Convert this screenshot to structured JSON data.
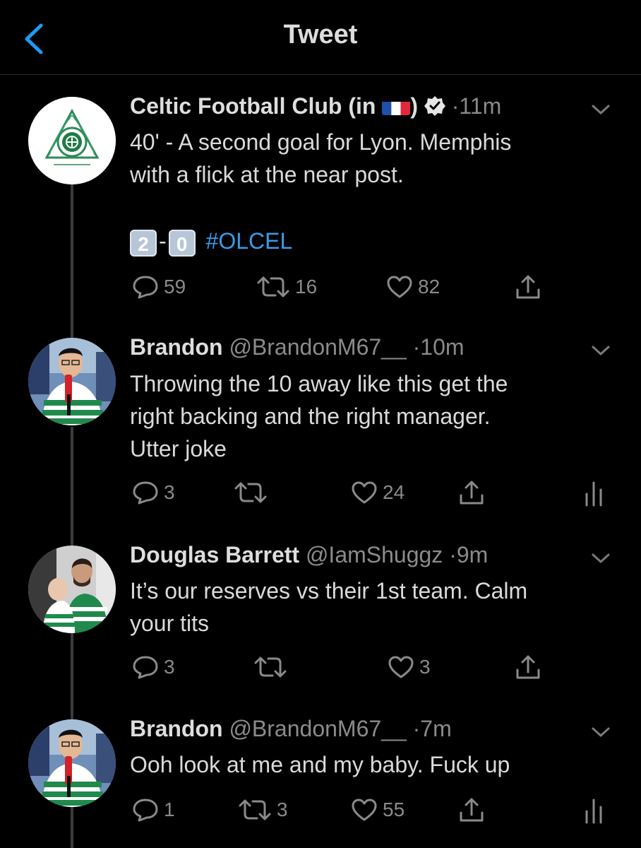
{
  "header": {
    "title": "Tweet"
  },
  "tweets": [
    {
      "name": "Celtic Football Club (in",
      "name_suffix": ")",
      "handle": "",
      "time": "11m",
      "text_line1": "40' - A second goal for Lyon. Memphis",
      "text_line2": "with a flick at the near post.",
      "score_home": "2",
      "score_sep": "-",
      "score_away": "0",
      "hashtag": "#OLCEL",
      "replies": "59",
      "retweets": "16",
      "likes": "82"
    },
    {
      "name": "Brandon",
      "handle": "@BrandonM67__",
      "time": "10m",
      "text_line1": "Throwing the 10 away like this get the",
      "text_line2": "right backing and the right manager.",
      "text_line3": "Utter joke",
      "replies": "3",
      "retweets": "",
      "likes": "24"
    },
    {
      "name": "Douglas Barrett",
      "handle": "@IamShuggz",
      "time": "9m",
      "text_line1": "It’s our reserves vs their 1st team. Calm",
      "text_line2": "your tits",
      "replies": "3",
      "retweets": "",
      "likes": "3"
    },
    {
      "name": "Brandon",
      "handle": "@BrandonM67__",
      "time": "7m",
      "text_line1": "Ooh look at me and my baby. Fuck up",
      "replies": "1",
      "retweets": "3",
      "likes": "55"
    }
  ],
  "time_separator": "·",
  "colors": {
    "background": "#000000",
    "accent": "#1d9bf0",
    "hashtag": "#3a9ae8",
    "text_primary": "#dadada",
    "text_secondary": "#8a8a8a",
    "thread_line": "#3b3b3b"
  },
  "icons": [
    "back-chevron-icon",
    "verified-badge-icon",
    "france-flag-icon",
    "caret-down-icon",
    "reply-icon",
    "retweet-icon",
    "like-icon",
    "share-icon",
    "analytics-icon"
  ]
}
